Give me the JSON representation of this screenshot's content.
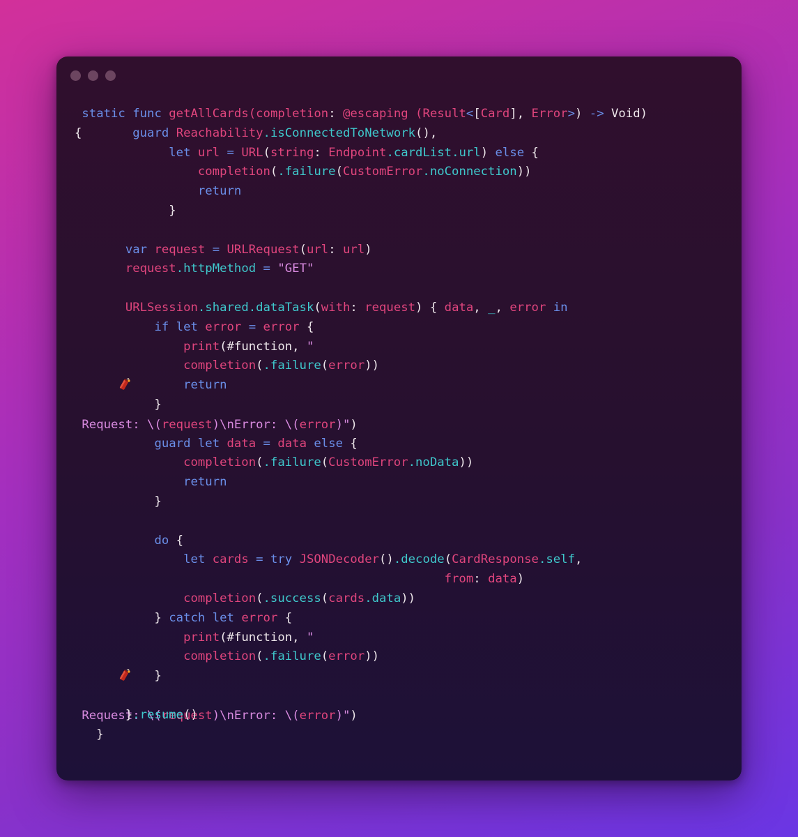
{
  "window": {
    "title_buttons": [
      "close",
      "minimize",
      "maximize"
    ]
  },
  "colors": {
    "background_gradient": [
      "#d2309a",
      "#a32fbf",
      "#6a36e4"
    ],
    "window_bg": "#2a0f2e",
    "keyword": "#6a8ee8",
    "identifier": "#e0457d",
    "property": "#3fc8cc",
    "plain": "#ede6ea",
    "string": "#d98be0"
  },
  "code": {
    "language": "swift",
    "lines": [
      [
        {
          "t": " "
        },
        {
          "t": "static",
          "c": "kw"
        },
        {
          "t": " "
        },
        {
          "t": "func",
          "c": "kw"
        },
        {
          "t": " "
        },
        {
          "t": "getAllCards",
          "c": "id"
        },
        {
          "t": "(",
          "c": "id"
        },
        {
          "t": "completion",
          "c": "id"
        },
        {
          "t": ": ",
          "c": "pl"
        },
        {
          "t": "@escaping",
          "c": "id"
        },
        {
          "t": " ",
          "c": "pl"
        },
        {
          "t": "(",
          "c": "id"
        },
        {
          "t": "Result",
          "c": "id"
        },
        {
          "t": "<",
          "c": "kw"
        },
        {
          "t": "[",
          "c": "pl"
        },
        {
          "t": "Card",
          "c": "id"
        },
        {
          "t": "], ",
          "c": "pl"
        },
        {
          "t": "Error",
          "c": "id"
        },
        {
          "t": ">",
          "c": "kw"
        },
        {
          "t": ") ",
          "c": "pl"
        },
        {
          "t": "->",
          "c": "kw"
        },
        {
          "t": " Void)",
          "c": "pl"
        }
      ],
      [
        {
          "t": "{",
          "c": "pl"
        },
        {
          "t": "       "
        },
        {
          "t": "guard",
          "c": "kw"
        },
        {
          "t": " "
        },
        {
          "t": "Reachability",
          "c": "id"
        },
        {
          "t": ".isConnectedToNetwork",
          "c": "prop"
        },
        {
          "t": "(),",
          "c": "pl"
        }
      ],
      [
        {
          "t": "             "
        },
        {
          "t": "let",
          "c": "kw"
        },
        {
          "t": " "
        },
        {
          "t": "url",
          "c": "id"
        },
        {
          "t": " = ",
          "c": "kw"
        },
        {
          "t": "URL",
          "c": "id"
        },
        {
          "t": "(",
          "c": "pl"
        },
        {
          "t": "string",
          "c": "id"
        },
        {
          "t": ": ",
          "c": "pl"
        },
        {
          "t": "Endpoint",
          "c": "id"
        },
        {
          "t": ".cardList.url",
          "c": "prop"
        },
        {
          "t": ") ",
          "c": "pl"
        },
        {
          "t": "else",
          "c": "kw"
        },
        {
          "t": " {",
          "c": "pl"
        }
      ],
      [
        {
          "t": "                 "
        },
        {
          "t": "completion",
          "c": "id"
        },
        {
          "t": "(",
          "c": "pl"
        },
        {
          "t": ".failure",
          "c": "prop"
        },
        {
          "t": "(",
          "c": "pl"
        },
        {
          "t": "CustomError",
          "c": "id"
        },
        {
          "t": ".noConnection",
          "c": "prop"
        },
        {
          "t": "))",
          "c": "pl"
        }
      ],
      [
        {
          "t": "                 "
        },
        {
          "t": "return",
          "c": "kw"
        }
      ],
      [
        {
          "t": "             "
        },
        {
          "t": "}",
          "c": "pl"
        }
      ],
      [],
      [
        {
          "t": "       "
        },
        {
          "t": "var",
          "c": "kw"
        },
        {
          "t": " "
        },
        {
          "t": "request",
          "c": "id"
        },
        {
          "t": " = ",
          "c": "kw"
        },
        {
          "t": "URLRequest",
          "c": "id"
        },
        {
          "t": "(",
          "c": "pl"
        },
        {
          "t": "url",
          "c": "id"
        },
        {
          "t": ": ",
          "c": "pl"
        },
        {
          "t": "url",
          "c": "id"
        },
        {
          "t": ")",
          "c": "pl"
        }
      ],
      [
        {
          "t": "       "
        },
        {
          "t": "request",
          "c": "id"
        },
        {
          "t": ".httpMethod",
          "c": "prop"
        },
        {
          "t": " = ",
          "c": "kw"
        },
        {
          "t": "\"GET\"",
          "c": "str"
        }
      ],
      [],
      [
        {
          "t": "       "
        },
        {
          "t": "URLSession",
          "c": "id"
        },
        {
          "t": ".shared.dataTask",
          "c": "prop"
        },
        {
          "t": "(",
          "c": "pl"
        },
        {
          "t": "with",
          "c": "id"
        },
        {
          "t": ": ",
          "c": "pl"
        },
        {
          "t": "request",
          "c": "id"
        },
        {
          "t": ") { ",
          "c": "pl"
        },
        {
          "t": "data",
          "c": "id"
        },
        {
          "t": ", ",
          "c": "pl"
        },
        {
          "t": "_",
          "c": "prop"
        },
        {
          "t": ", ",
          "c": "pl"
        },
        {
          "t": "error",
          "c": "id"
        },
        {
          "t": " "
        },
        {
          "t": "in",
          "c": "kw"
        }
      ],
      [
        {
          "t": "           "
        },
        {
          "t": "if",
          "c": "kw"
        },
        {
          "t": " "
        },
        {
          "t": "let",
          "c": "kw"
        },
        {
          "t": " "
        },
        {
          "t": "error",
          "c": "id"
        },
        {
          "t": " = ",
          "c": "kw"
        },
        {
          "t": "error",
          "c": "id"
        },
        {
          "t": " {",
          "c": "pl"
        }
      ],
      [
        {
          "t": "               "
        },
        {
          "t": "print",
          "c": "id"
        },
        {
          "t": "(#function, ",
          "c": "pl"
        },
        {
          "t": "\"",
          "c": "str"
        },
        {
          "emoji": "firecracker"
        },
        {
          "t": " Request: \\(",
          "c": "str"
        },
        {
          "t": "request",
          "c": "id"
        },
        {
          "t": ")\\nError: \\(",
          "c": "str"
        },
        {
          "t": "error",
          "c": "id"
        },
        {
          "t": ")\"",
          "c": "str"
        },
        {
          "t": ")",
          "c": "pl"
        }
      ],
      [
        {
          "t": "               "
        },
        {
          "t": "completion",
          "c": "id"
        },
        {
          "t": "(",
          "c": "pl"
        },
        {
          "t": ".failure",
          "c": "prop"
        },
        {
          "t": "(",
          "c": "pl"
        },
        {
          "t": "error",
          "c": "id"
        },
        {
          "t": "))",
          "c": "pl"
        }
      ],
      [
        {
          "t": "               "
        },
        {
          "t": "return",
          "c": "kw"
        }
      ],
      [
        {
          "t": "           "
        },
        {
          "t": "}",
          "c": "pl"
        }
      ],
      [],
      [
        {
          "t": "           "
        },
        {
          "t": "guard",
          "c": "kw"
        },
        {
          "t": " "
        },
        {
          "t": "let",
          "c": "kw"
        },
        {
          "t": " "
        },
        {
          "t": "data",
          "c": "id"
        },
        {
          "t": " = ",
          "c": "kw"
        },
        {
          "t": "data",
          "c": "id"
        },
        {
          "t": " "
        },
        {
          "t": "else",
          "c": "kw"
        },
        {
          "t": " {",
          "c": "pl"
        }
      ],
      [
        {
          "t": "               "
        },
        {
          "t": "completion",
          "c": "id"
        },
        {
          "t": "(",
          "c": "pl"
        },
        {
          "t": ".failure",
          "c": "prop"
        },
        {
          "t": "(",
          "c": "pl"
        },
        {
          "t": "CustomError",
          "c": "id"
        },
        {
          "t": ".noData",
          "c": "prop"
        },
        {
          "t": "))",
          "c": "pl"
        }
      ],
      [
        {
          "t": "               "
        },
        {
          "t": "return",
          "c": "kw"
        }
      ],
      [
        {
          "t": "           "
        },
        {
          "t": "}",
          "c": "pl"
        }
      ],
      [],
      [
        {
          "t": "           "
        },
        {
          "t": "do",
          "c": "kw"
        },
        {
          "t": " {",
          "c": "pl"
        }
      ],
      [
        {
          "t": "               "
        },
        {
          "t": "let",
          "c": "kw"
        },
        {
          "t": " "
        },
        {
          "t": "cards",
          "c": "id"
        },
        {
          "t": " = ",
          "c": "kw"
        },
        {
          "t": "try",
          "c": "kw"
        },
        {
          "t": " "
        },
        {
          "t": "JSONDecoder",
          "c": "id"
        },
        {
          "t": "()",
          "c": "pl"
        },
        {
          "t": ".decode",
          "c": "prop"
        },
        {
          "t": "(",
          "c": "pl"
        },
        {
          "t": "CardResponse",
          "c": "id"
        },
        {
          "t": ".self",
          "c": "prop"
        },
        {
          "t": ",",
          "c": "pl"
        }
      ],
      [
        {
          "t": "                                                   "
        },
        {
          "t": "from",
          "c": "id"
        },
        {
          "t": ": ",
          "c": "pl"
        },
        {
          "t": "data",
          "c": "id"
        },
        {
          "t": ")",
          "c": "pl"
        }
      ],
      [
        {
          "t": "               "
        },
        {
          "t": "completion",
          "c": "id"
        },
        {
          "t": "(",
          "c": "pl"
        },
        {
          "t": ".success",
          "c": "prop"
        },
        {
          "t": "(",
          "c": "pl"
        },
        {
          "t": "cards",
          "c": "id"
        },
        {
          "t": ".data",
          "c": "prop"
        },
        {
          "t": "))",
          "c": "pl"
        }
      ],
      [
        {
          "t": "           "
        },
        {
          "t": "} ",
          "c": "pl"
        },
        {
          "t": "catch",
          "c": "kw"
        },
        {
          "t": " "
        },
        {
          "t": "let",
          "c": "kw"
        },
        {
          "t": " "
        },
        {
          "t": "error",
          "c": "id"
        },
        {
          "t": " {",
          "c": "pl"
        }
      ],
      [
        {
          "t": "               "
        },
        {
          "t": "print",
          "c": "id"
        },
        {
          "t": "(#function, ",
          "c": "pl"
        },
        {
          "t": "\"",
          "c": "str"
        },
        {
          "emoji": "firecracker"
        },
        {
          "t": " Request: \\(",
          "c": "str"
        },
        {
          "t": "request",
          "c": "id"
        },
        {
          "t": ")\\nError: \\(",
          "c": "str"
        },
        {
          "t": "error",
          "c": "id"
        },
        {
          "t": ")\"",
          "c": "str"
        },
        {
          "t": ")",
          "c": "pl"
        }
      ],
      [
        {
          "t": "               "
        },
        {
          "t": "completion",
          "c": "id"
        },
        {
          "t": "(",
          "c": "pl"
        },
        {
          "t": ".failure",
          "c": "prop"
        },
        {
          "t": "(",
          "c": "pl"
        },
        {
          "t": "error",
          "c": "id"
        },
        {
          "t": "))",
          "c": "pl"
        }
      ],
      [
        {
          "t": "           "
        },
        {
          "t": "}",
          "c": "pl"
        }
      ],
      [],
      [
        {
          "t": "       "
        },
        {
          "t": "}",
          "c": "pl"
        },
        {
          "t": ".resume",
          "c": "prop"
        },
        {
          "t": "()",
          "c": "pl"
        }
      ],
      [
        {
          "t": "   "
        },
        {
          "t": "}",
          "c": "pl"
        }
      ]
    ]
  }
}
